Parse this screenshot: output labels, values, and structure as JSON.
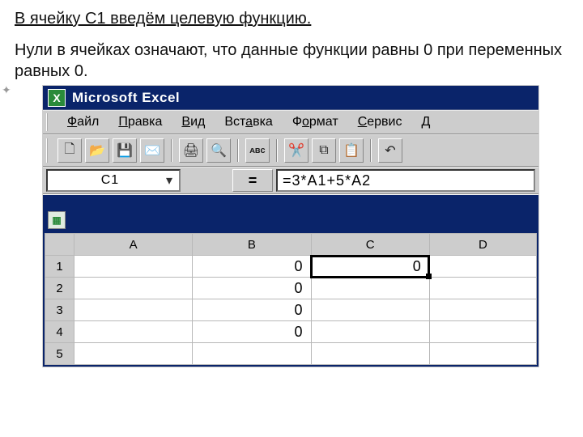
{
  "heading": "В ячейку С1 введём целевую функцию.",
  "body_text": "Нули в ячейках означают, что данные функции равны 0 при переменных равных 0.",
  "window": {
    "title": "Microsoft Excel"
  },
  "menu": {
    "file": "Файл",
    "edit": "Правка",
    "view": "Вид",
    "insert": "Вставка",
    "format": "Формат",
    "tools": "Сервис",
    "d": "Д"
  },
  "toolbar_icons": {
    "new": "🗋",
    "open": "📂",
    "save": "💾",
    "mail": "✉️",
    "print": "🖨",
    "preview": "🔍",
    "spell": "ᴀʙᴄ",
    "cut": "✂️",
    "copy": "⧉",
    "paste": "📋",
    "undo": "↶"
  },
  "formula": {
    "name_box": "C1",
    "name_dd": "▾",
    "eq": "=",
    "content": "=3*A1+5*A2"
  },
  "grid": {
    "columns": [
      "A",
      "B",
      "C",
      "D"
    ],
    "rows": [
      {
        "n": "1",
        "A": "",
        "B": "0",
        "C": "0",
        "D": ""
      },
      {
        "n": "2",
        "A": "",
        "B": "0",
        "C": "",
        "D": ""
      },
      {
        "n": "3",
        "A": "",
        "B": "0",
        "C": "",
        "D": ""
      },
      {
        "n": "4",
        "A": "",
        "B": "0",
        "C": "",
        "D": ""
      },
      {
        "n": "5",
        "A": "",
        "B": "",
        "C": "",
        "D": ""
      }
    ],
    "selected": "C1"
  }
}
